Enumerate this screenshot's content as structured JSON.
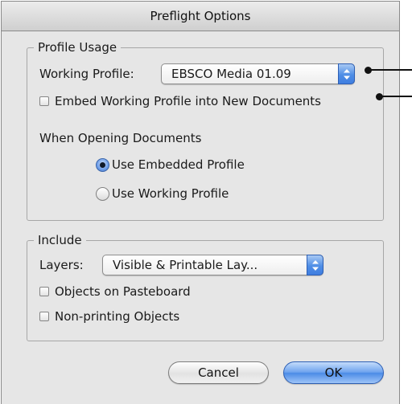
{
  "dialog": {
    "title": "Preflight Options"
  },
  "profile_usage": {
    "group_label": "Profile Usage",
    "working_profile_label": "Working Profile:",
    "working_profile_value": "EBSCO Media 01.09",
    "embed_checkbox_label": "Embed Working Profile into New Documents",
    "embed_checked": false,
    "when_opening_label": "When Opening Documents",
    "radio_options": [
      {
        "label": "Use Embedded Profile",
        "selected": true
      },
      {
        "label": "Use Working Profile",
        "selected": false
      }
    ]
  },
  "include": {
    "group_label": "Include",
    "layers_label": "Layers:",
    "layers_value": "Visible & Printable Lay...",
    "checkboxes": [
      {
        "label": "Objects on Pasteboard",
        "checked": false
      },
      {
        "label": "Non-printing Objects",
        "checked": false
      }
    ]
  },
  "buttons": {
    "cancel": "Cancel",
    "ok": "OK"
  },
  "colors": {
    "accent": "#4b8be6",
    "dialog_bg": "#e6e6e6"
  }
}
